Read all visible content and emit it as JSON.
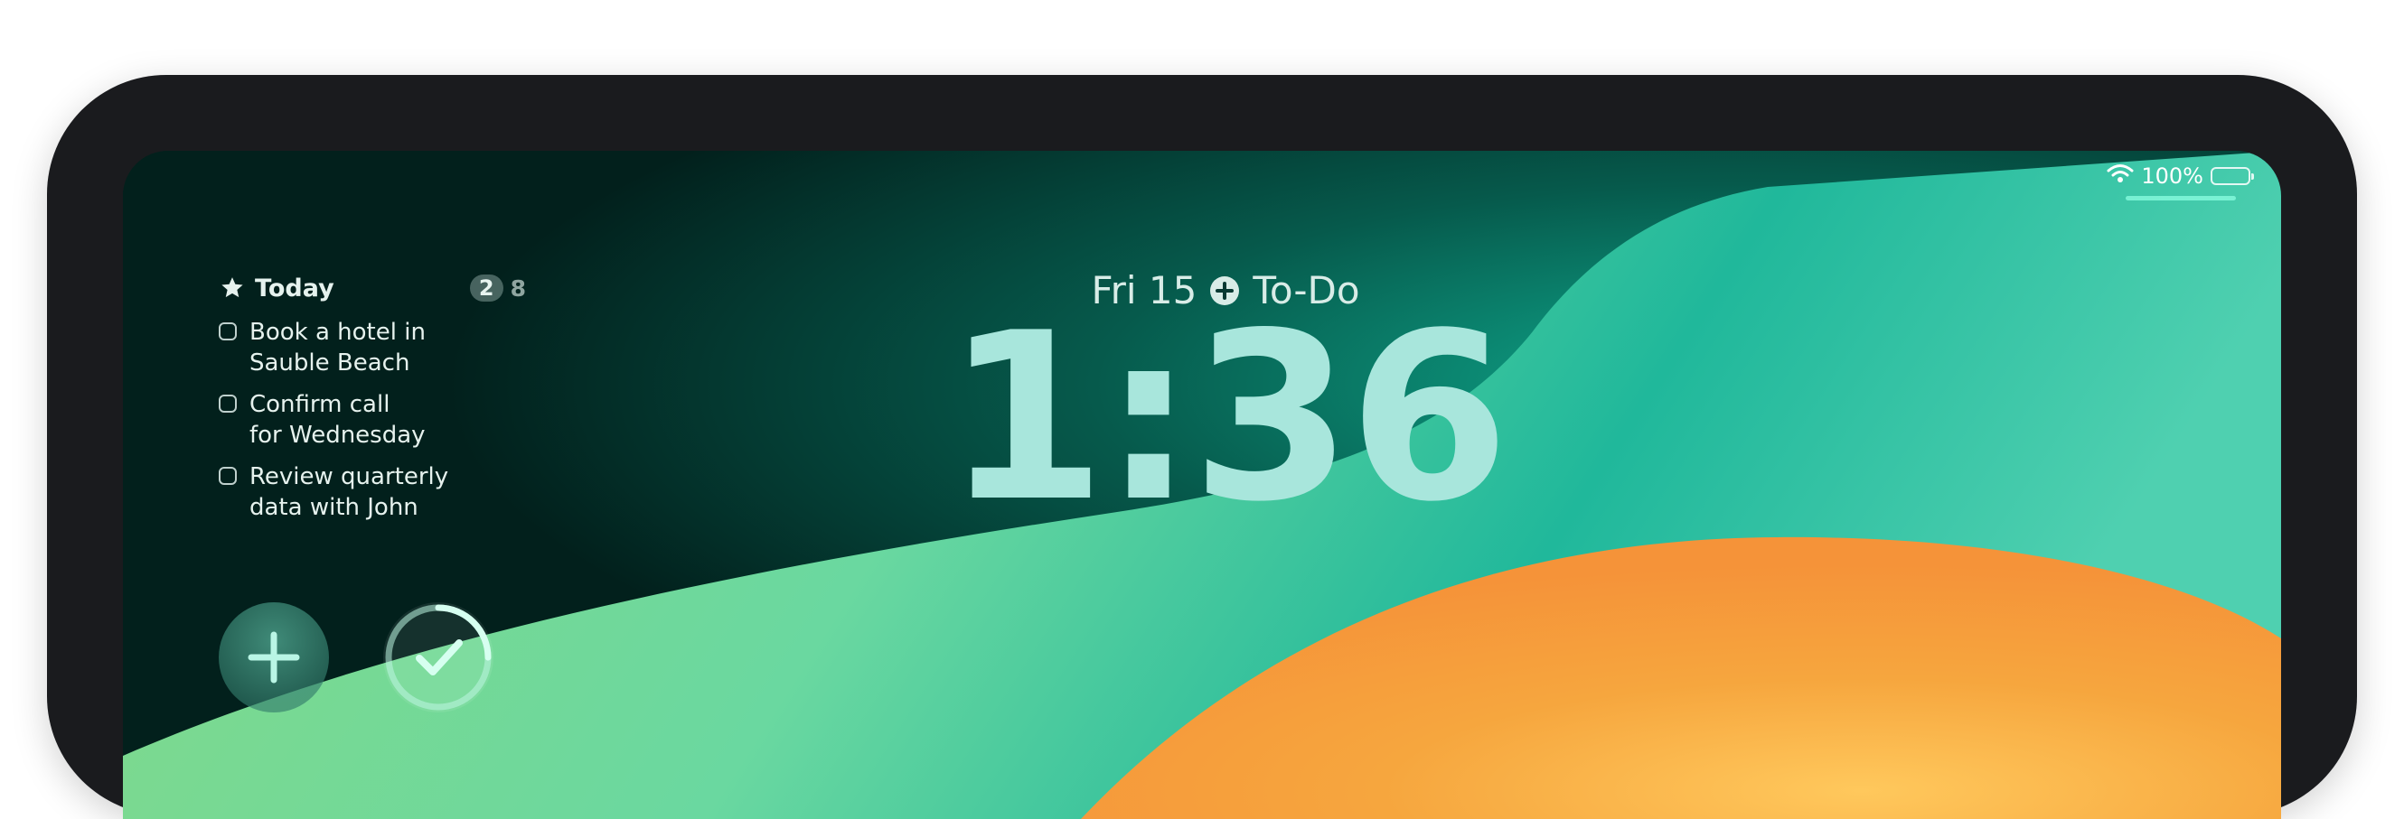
{
  "status_bar": {
    "wifi_icon": "wifi-icon",
    "battery_text": "100%",
    "battery_level": 1.0
  },
  "widget": {
    "title": "Today",
    "icon": "star-icon",
    "badge_count": "2",
    "total_count": "8",
    "tasks": [
      {
        "label": "Book a hotel in\nSauble Beach"
      },
      {
        "label": "Confirm call\nfor Wednesday"
      },
      {
        "label": "Review quarterly\ndata with John"
      }
    ]
  },
  "date_line": {
    "date": "Fri 15",
    "icon": "plus-circle-icon",
    "app_label": "To-Do"
  },
  "clock": {
    "time": "1:36"
  },
  "buttons": {
    "add_icon": "plus-icon",
    "done_icon": "checkmark-icon",
    "done_progress": 0.25
  },
  "colors": {
    "bezel": "#1a1b1e",
    "dark_teal": "#02201c",
    "teal": "#1bb39a",
    "green": "#7cd98e",
    "orange": "#f79b3b",
    "clock": "#a8e6dc"
  }
}
